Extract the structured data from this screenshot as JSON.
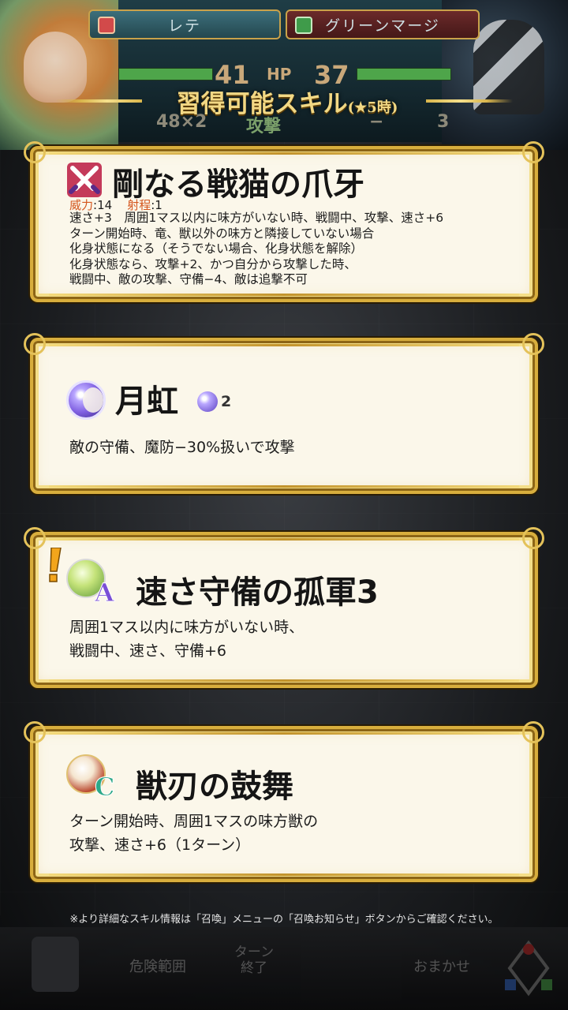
{
  "hud": {
    "left_unit_name": "レテ",
    "right_unit_name": "グリーンマージ",
    "left_hp": "41",
    "hp_label": "HP",
    "right_hp": "37",
    "left_damage": "48×2",
    "stat_label": "攻撃",
    "right_damage": "−",
    "right_count": "3"
  },
  "banner": {
    "title": "習得可能スキル",
    "subtitle": "(★5時)"
  },
  "skills": [
    {
      "name": "剛なる戦猫の爪牙",
      "might_label": "威力",
      "might_value": ":14",
      "range_label": "射程",
      "range_value": ":1",
      "desc_lines": [
        "速さ+3　周囲1マス以内に味方がいない時、戦闘中、攻撃、速さ+6",
        "ターン開始時、竜、獣以外の味方と隣接していない場合",
        "化身状態になる（そうでない場合、化身状態を解除）",
        "化身状態なら、攻撃+2、かつ自分から攻撃した時、",
        "戦闘中、敵の攻撃、守備−4、敵は追撃不可"
      ]
    },
    {
      "name": "月虹",
      "cooldown": "2",
      "desc_lines": [
        "敵の守備、魔防−30%扱いで攻撃"
      ]
    },
    {
      "name": "速さ守備の孤軍3",
      "slot": "A",
      "desc_lines": [
        "周囲1マス以内に味方がいない時、",
        "戦闘中、速さ、守備+6"
      ]
    },
    {
      "name": "獣刃の鼓舞",
      "slot": "C",
      "desc_lines": [
        "ターン開始時、周囲1マスの味方獣の",
        "攻撃、速さ+6（1ターン）"
      ]
    }
  ],
  "footnote": "※より詳細なスキル情報は「召喚」メニューの「召喚お知らせ」ボタンからご確認ください。",
  "bottom_bar": {
    "danger_label": "危険範囲",
    "turn_end_line1": "ターン",
    "turn_end_line2": "終了",
    "auto_label": "おまかせ"
  },
  "colors": {
    "gold": "#d8ae3d",
    "card_bg": "#fbf7ea",
    "might_orange": "#d4561e",
    "title_gold": "#f2d884"
  }
}
